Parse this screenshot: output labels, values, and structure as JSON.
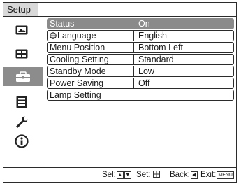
{
  "menu": {
    "title": "Setup"
  },
  "sidebar": {
    "items": [
      {
        "icon": "picture-icon",
        "selected": false
      },
      {
        "icon": "screen-icon",
        "selected": false
      },
      {
        "icon": "setup-toolbox-icon",
        "selected": true
      },
      {
        "icon": "menu-list-icon",
        "selected": false
      },
      {
        "icon": "wrench-icon",
        "selected": false
      },
      {
        "icon": "info-icon",
        "selected": false
      }
    ]
  },
  "settings": {
    "rows": [
      {
        "label": "Status",
        "value": "On",
        "selected": true
      },
      {
        "label": "Language",
        "value": "English",
        "icon": "globe-icon"
      },
      {
        "label": "Menu Position",
        "value": "Bottom Left"
      },
      {
        "label": "Cooling Setting",
        "value": "Standard"
      },
      {
        "label": "Standby Mode",
        "value": "Low"
      },
      {
        "label": "Power Saving",
        "value": "Off"
      },
      {
        "label": "Lamp Setting",
        "value": ""
      }
    ]
  },
  "status_bar": {
    "sel_label": "Sel:",
    "set_label": "Set:",
    "back_label": "Back:",
    "exit_label": "Exit:",
    "exit_key": "MENU"
  },
  "colors": {
    "selected_row": "#8a8a8a",
    "title_tab": "#d9d9d9",
    "border": "#2b2b2b"
  }
}
